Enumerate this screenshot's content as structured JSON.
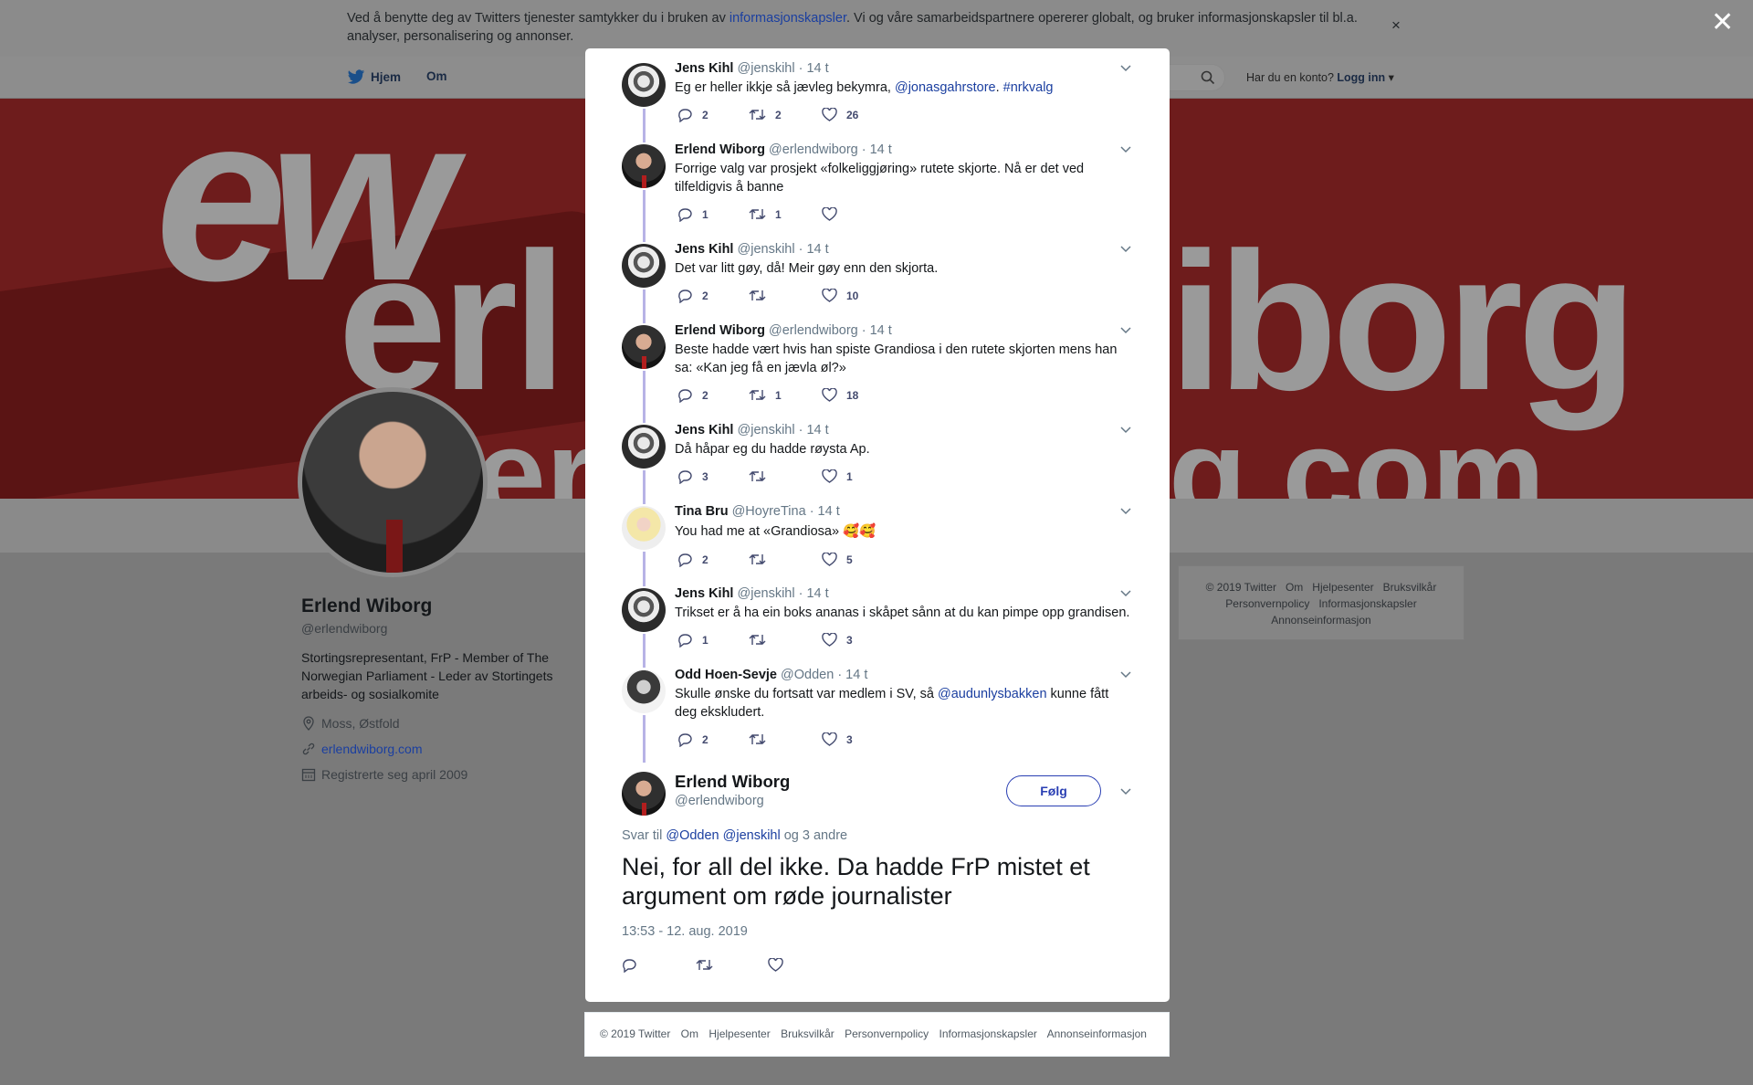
{
  "cookie": {
    "text_before": "Ved å benytte deg av Twitters tjenester samtykker du i bruken av ",
    "link": "informasjonskapsler",
    "text_after": ". Vi og våre samarbeidspartnere opererer globalt, og bruker informasjonskapsler til bl.a. analyser, personalisering og annonser.",
    "close": "×"
  },
  "nav": {
    "home": "Hjem",
    "about": "Om",
    "account_prompt": "Har du en konto?",
    "login": "Logg inn"
  },
  "banner": {
    "logo": "ew",
    "word_left": "erl",
    "word_right": "iborg",
    "domain_left": "er",
    "domain_right": "g.com"
  },
  "profile": {
    "name": "Erlend Wiborg",
    "handle": "@erlendwiborg",
    "bio": "Stortingsrepresentant, FrP - Member of The Norwegian Parliament - Leder av Stortingets arbeids- og sosialkomite",
    "location": "Moss, Østfold",
    "website": "erlendwiborg.com",
    "joined": "Registrerte seg april 2009"
  },
  "side_footer": {
    "items": [
      "© 2019 Twitter",
      "Om",
      "Hjelpesenter",
      "Bruksvilkår",
      "Personvernpolicy",
      "Informasjonskapsler",
      "Annonseinformasjon"
    ]
  },
  "overlay_close": "✕",
  "thread": [
    {
      "name": "Jens Kihl",
      "handle": "@jenskihl",
      "time": "· 14 t",
      "text": "Eg er heller ikkje så jævleg bekymra, ",
      "link1": "@jonasgahrstore",
      "text2": ". ",
      "link2": "#nrkvalg",
      "replies": "2",
      "retweets": "2",
      "likes": "26"
    },
    {
      "name": "Erlend Wiborg",
      "handle": "@erlendwiborg",
      "time": "· 14 t",
      "text": "Forrige valg var prosjekt «folkeliggjøring» rutete skjorte. Nå er det ved tilfeldigvis å banne",
      "replies": "1",
      "retweets": "1",
      "likes": ""
    },
    {
      "name": "Jens Kihl",
      "handle": "@jenskihl",
      "time": "· 14 t",
      "text": "Det var litt gøy, då! Meir gøy enn den skjorta.",
      "replies": "2",
      "retweets": "",
      "likes": "10"
    },
    {
      "name": "Erlend Wiborg",
      "handle": "@erlendwiborg",
      "time": "· 14 t",
      "text": "Beste hadde vært hvis han spiste Grandiosa i den rutete skjorten mens han sa: «Kan jeg få en jævla øl?»",
      "replies": "2",
      "retweets": "1",
      "likes": "18"
    },
    {
      "name": "Jens Kihl",
      "handle": "@jenskihl",
      "time": "· 14 t",
      "text": "Då håpar eg du hadde røysta Ap.",
      "replies": "3",
      "retweets": "",
      "likes": "1"
    },
    {
      "name": "Tina Bru",
      "handle": "@HoyreTina",
      "time": "· 14 t",
      "text": "You had me at «Grandiosa» 🥰🥰",
      "replies": "2",
      "retweets": "",
      "likes": "5"
    },
    {
      "name": "Jens Kihl",
      "handle": "@jenskihl",
      "time": "· 14 t",
      "text": "Trikset er å ha ein boks ananas i skåpet sånn at du kan pimpe opp grandisen.",
      "replies": "1",
      "retweets": "",
      "likes": "3"
    },
    {
      "name": "Odd Hoen-Sevje",
      "handle": "@Odden",
      "time": "· 14 t",
      "text": "Skulle ønske du fortsatt var medlem i SV, så ",
      "link1": "@audunlysbakken",
      "text2": " kunne fått deg ekskludert.",
      "replies": "2",
      "retweets": "",
      "likes": "3"
    }
  ],
  "focus_tweet": {
    "name": "Erlend Wiborg",
    "handle": "@erlendwiborg",
    "follow": "Følg",
    "reply_prefix": "Svar til ",
    "reply_user1": "@Odden",
    "reply_user2": "@jenskihl",
    "reply_suffix": " og 3 andre",
    "text": "Nei, for all del ikke. Da hadde FrP mistet et argument om røde journalister",
    "date": "13:53 - 12. aug. 2019"
  },
  "modal_footer": {
    "items": [
      "© 2019 Twitter",
      "Om",
      "Hjelpesenter",
      "Bruksvilkår",
      "Personvernpolicy",
      "Informasjonskapsler",
      "Annonseinformasjon"
    ]
  },
  "icons": [
    "twitter-bird-icon",
    "search-icon",
    "caret-down-icon",
    "reply-icon",
    "retweet-icon",
    "like-icon",
    "location-icon",
    "link-icon",
    "calendar-icon",
    "close-icon"
  ],
  "colors": {
    "link": "#1b3fa0",
    "accent": "#2a3fb3",
    "thread_line": "#b7b3e6",
    "overlay": "#7a7a7a"
  }
}
